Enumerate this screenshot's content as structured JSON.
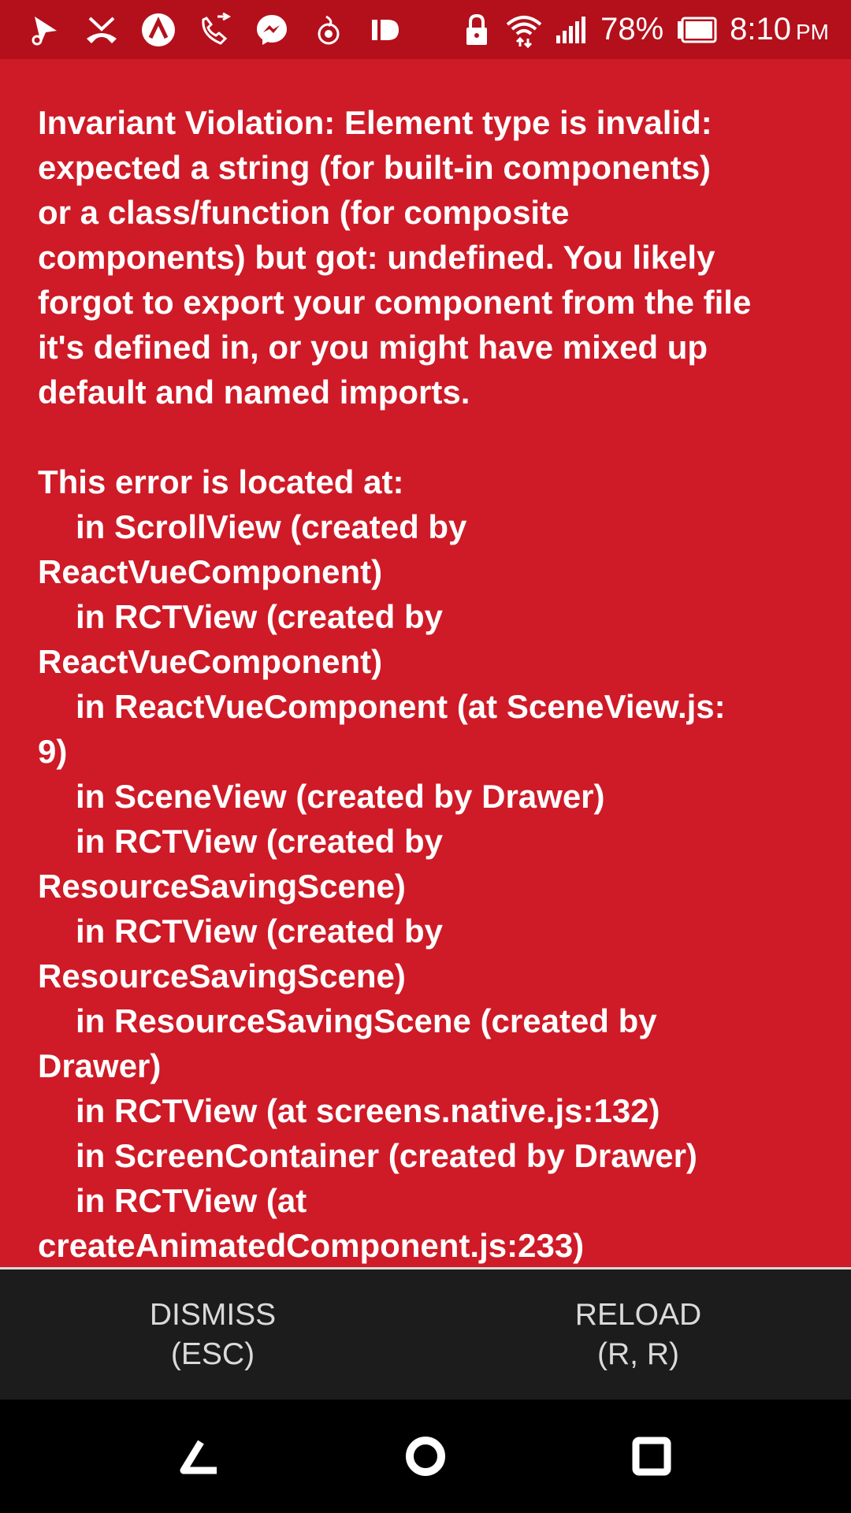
{
  "status_bar": {
    "left_icons": [
      "navigation-icon",
      "missed-call-icon",
      "app-a-icon",
      "call-forward-icon",
      "messenger-icon",
      "hotspot-app-icon",
      "id-app-icon"
    ],
    "right_icons": [
      "lock-icon",
      "wifi-icon",
      "signal-icon",
      "battery-icon"
    ],
    "battery_percent": "78%",
    "time": "8:10",
    "ampm": "PM"
  },
  "error": {
    "lines": [
      "Invariant Violation: Element type is invalid:",
      "expected a string (for built-in components)",
      "or a class/function (for composite",
      "components) but got: undefined. You likely",
      "forgot to export your component from the file",
      "it's defined in, or you might have mixed up",
      "default and named imports."
    ],
    "stack_title": "This error is located at:",
    "stack": [
      {
        "indent": true,
        "text": "in ScrollView (created by"
      },
      {
        "indent": false,
        "text": "ReactVueComponent)"
      },
      {
        "indent": true,
        "text": "in RCTView (created by"
      },
      {
        "indent": false,
        "text": "ReactVueComponent)"
      },
      {
        "indent": true,
        "text": "in ReactVueComponent (at SceneView.js:"
      },
      {
        "indent": false,
        "text": "9)"
      },
      {
        "indent": true,
        "text": "in SceneView (created by Drawer)"
      },
      {
        "indent": true,
        "text": "in RCTView (created by"
      },
      {
        "indent": false,
        "text": "ResourceSavingScene)"
      },
      {
        "indent": true,
        "text": "in RCTView (created by"
      },
      {
        "indent": false,
        "text": "ResourceSavingScene)"
      },
      {
        "indent": true,
        "text": "in ResourceSavingScene (created by"
      },
      {
        "indent": false,
        "text": "Drawer)"
      },
      {
        "indent": true,
        "text": "in RCTView (at screens.native.js:132)"
      },
      {
        "indent": true,
        "text": "in ScreenContainer (created by Drawer)"
      },
      {
        "indent": true,
        "text": "in RCTView (at"
      },
      {
        "indent": false,
        "text": "createAnimatedComponent.js:233)"
      }
    ]
  },
  "buttons": {
    "dismiss": {
      "label": "DISMISS",
      "shortcut": "(ESC)"
    },
    "reload": {
      "label": "RELOAD",
      "shortcut": "(R, R)"
    }
  },
  "nav_bar": {
    "icons": [
      "back-icon",
      "home-icon",
      "recents-icon"
    ]
  },
  "colors": {
    "status_bar": "#b3101c",
    "error_background": "#cf1a27",
    "button_bar": "#1c1c1c",
    "nav_bar": "#000000"
  }
}
